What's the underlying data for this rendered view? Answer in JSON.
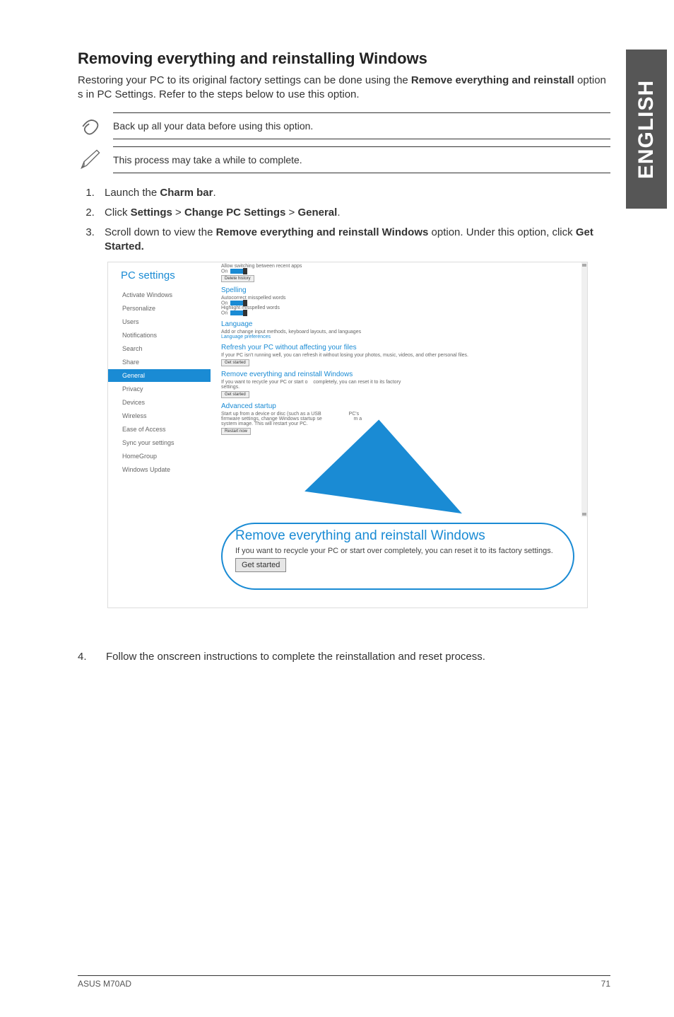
{
  "sidebar_tab": "ENGLISH",
  "title": "Removing everything and reinstalling Windows",
  "intro_pre": "Restoring your PC to its original factory settings can be done using the ",
  "intro_bold1": "Remove everything and reinstall",
  "intro_mid": " option s in PC Settings. Refer to the steps below to use this option.",
  "note1": "Back up all your data before using this option.",
  "note2": "This process may take a while to complete.",
  "steps": {
    "s1_pre": "Launch the ",
    "s1_b": "Charm bar",
    "s1_post": ".",
    "s2_pre": "Click ",
    "s2_b1": "Settings",
    "s2_gt1": " > ",
    "s2_b2": "Change PC Settings",
    "s2_gt2": " > ",
    "s2_b3": "General",
    "s2_post": ".",
    "s3_pre": "Scroll down to view the ",
    "s3_b1": "Remove everything and reinstall Windows",
    "s3_mid": " option. Under this option, click ",
    "s3_b2": "Get Started.",
    "s4": "Follow the onscreen instructions to complete the reinstallation and reset process."
  },
  "screenshot": {
    "pc_settings": "PC settings",
    "sidebar": [
      "Activate Windows",
      "Personalize",
      "Users",
      "Notifications",
      "Search",
      "Share",
      "General",
      "Privacy",
      "Devices",
      "Wireless",
      "Ease of Access",
      "Sync your settings",
      "HomeGroup",
      "Windows Update"
    ],
    "selected": "General",
    "top_line": "Allow switching between recent apps",
    "on": "On",
    "delete_history": "Delete history",
    "spelling": "Spelling",
    "spell_a": "Autocorrect misspelled words",
    "spell_b": "Highlight misspelled words",
    "language": "Language",
    "lang_txt": "Add or change input methods, keyboard layouts, and languages",
    "lang_link": "Language preferences",
    "refresh": "Refresh your PC without affecting your files",
    "refresh_txt": "If your PC isn't running well, you can refresh it without losing your photos, music, videos, and other personal files.",
    "get_started": "Get started",
    "remove": "Remove everything and reinstall Windows",
    "remove_txt_p1": "If you want to recycle your PC or start o",
    "remove_txt_p2": "completely, you can reset it to its factory",
    "remove_txt_line2": "settings.",
    "advanced": "Advanced startup",
    "adv_txt1": "Start up from a device or disc (such as a USB",
    "adv_txt2": "firmware settings, change Windows startup se",
    "adv_txt3": "system image. This will restart your PC.",
    "adv_pc": "PC's",
    "adv_ma": "m a",
    "restart_now": "Restart now"
  },
  "callout": {
    "title": "Remove everything and reinstall Windows",
    "body": "If you want to recycle your PC or start over completely, you can reset it to its factory settings.",
    "btn": "Get started"
  },
  "footer_left": "ASUS M70AD",
  "footer_right": "71"
}
